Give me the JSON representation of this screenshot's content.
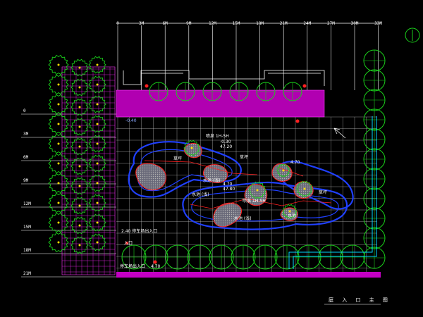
{
  "grid": {
    "col_labels": [
      "0",
      "3M",
      "6M",
      "9M",
      "12M",
      "15M",
      "18M",
      "21M",
      "24M",
      "27M",
      "30M",
      "33M"
    ],
    "row_labels": [
      "0",
      "3M",
      "6M",
      "9M",
      "12M",
      "15M",
      "18M",
      "21M"
    ]
  },
  "annotations": {
    "top_level": "-0.40",
    "center_label": "喷泉 1H-5H",
    "center_val_a": "-0.30",
    "center_val_b": "47.20",
    "mid_label": "4.70",
    "mid_val_a": "47.80",
    "mid_val_b": "喷泉 1H-5H",
    "lawn_left": "草坪",
    "lawn_left_b": "草坪",
    "pond_a": "水池 (浅)",
    "pond_b": "水池 (浅)",
    "pond_c": "水池 (浅)",
    "pond_d": "水池",
    "right_label_a": "4.70",
    "right_label_b": "草坪",
    "left_note": "2.40 停车场出入口",
    "entrance": "入口",
    "bottom_level": "4.70",
    "bottom_left": "停车场出入口"
  },
  "sheet": {
    "title": "庭 入 口 主 图"
  }
}
